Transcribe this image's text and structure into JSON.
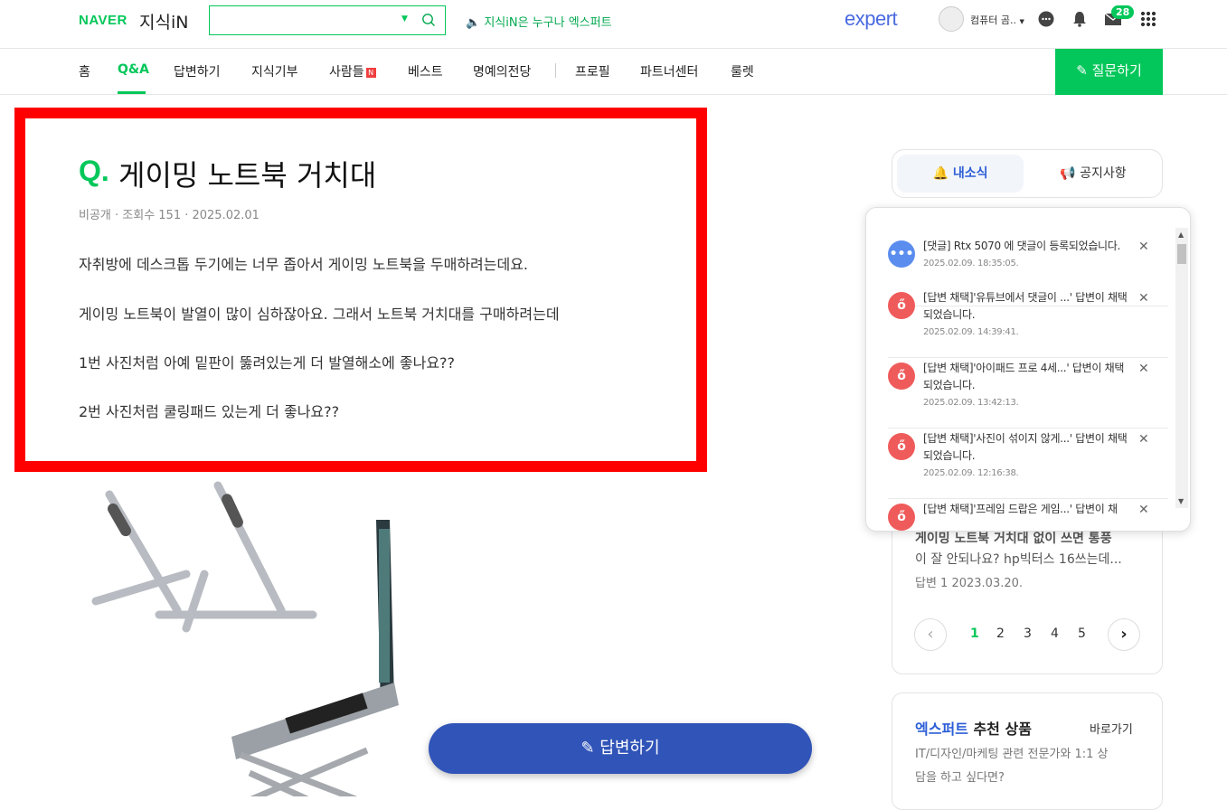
{
  "header": {
    "naver_logo": "NAVER",
    "kin_logo": "지식iN",
    "search_value": "",
    "promo_text": "지식iN은 누구나 엑스퍼트",
    "expert_logo": "expert",
    "user_name": "컴퓨터 곰..",
    "mail_count": "28"
  },
  "nav": {
    "items": [
      "홈",
      "Q&A",
      "답변하기",
      "지식기부",
      "사람들",
      "베스트",
      "명예의전당",
      "프로필",
      "파트너센터",
      "룰렛"
    ],
    "new_badge": "N",
    "ask_button": "질문하기"
  },
  "question": {
    "q_mark": "Q.",
    "title": "게이밍 노트북 거치대",
    "meta": "비공개 · 조회수 151 · 2025.02.01",
    "body": [
      "자취방에 데스크톱 두기에는 너무 좁아서 게이밍 노트북을 두매하려는데요.",
      "게이밍 노트북이 발열이 많이 심하잖아요. 그래서 노트북 거치대를 구매하려는데",
      "1번 사진처럼 아예 밑판이 뚫려있는게 더 발열해소에 좋나요??",
      "2번 사진처럼 쿨링패드 있는게 더 좋나요??"
    ]
  },
  "answer_button": "답변하기",
  "side_tabs": {
    "news": "내소식",
    "notice": "공지사항"
  },
  "notifications": [
    {
      "text": "[댓글] Rtx 5070 에 댓글이 등록되었습니다.",
      "date": "2025.02.09. 18:35:05.",
      "type": "comment"
    },
    {
      "text": "[답변 채택]'유튜브에서 댓글이 ...' 답변이 채택되었습니다.",
      "date": "2025.02.09. 14:39:41.",
      "type": "adopt"
    },
    {
      "text": "[답변 채택]'아이패드 프로 4세...' 답변이 채택되었습니다.",
      "date": "2025.02.09. 13:42:13.",
      "type": "adopt"
    },
    {
      "text": "[답변 채택]'사진이 섞이지 않게...' 답변이 채택되었습니다.",
      "date": "2025.02.09. 12:16:38.",
      "type": "adopt"
    },
    {
      "text": "[답변 채택]'프레임 드랍은 게임...' 답변이 채",
      "date": "",
      "type": "adopt"
    }
  ],
  "related": {
    "line1": "게이밍 노트북 거치대 없이 쓰면 통풍",
    "line2": "이 잘 안되나요? hp빅터스 16쓰는데...",
    "meta": "답변 1   2023.03.20.",
    "pages": [
      "1",
      "2",
      "3",
      "4",
      "5"
    ]
  },
  "expert_box": {
    "title_blue": "엑스퍼트",
    "title_rest": " 추천 상품",
    "go": "바로가기",
    "line1": "IT/디자인/마케팅 관련 전문가와 1:1 상",
    "line2": "담을 하고 싶다면?"
  },
  "colors": {
    "naver_green": "#03c75a",
    "answer_blue": "#3054b8",
    "highlight_red": "#ff0000",
    "expert_blue": "#2c5ed6"
  }
}
